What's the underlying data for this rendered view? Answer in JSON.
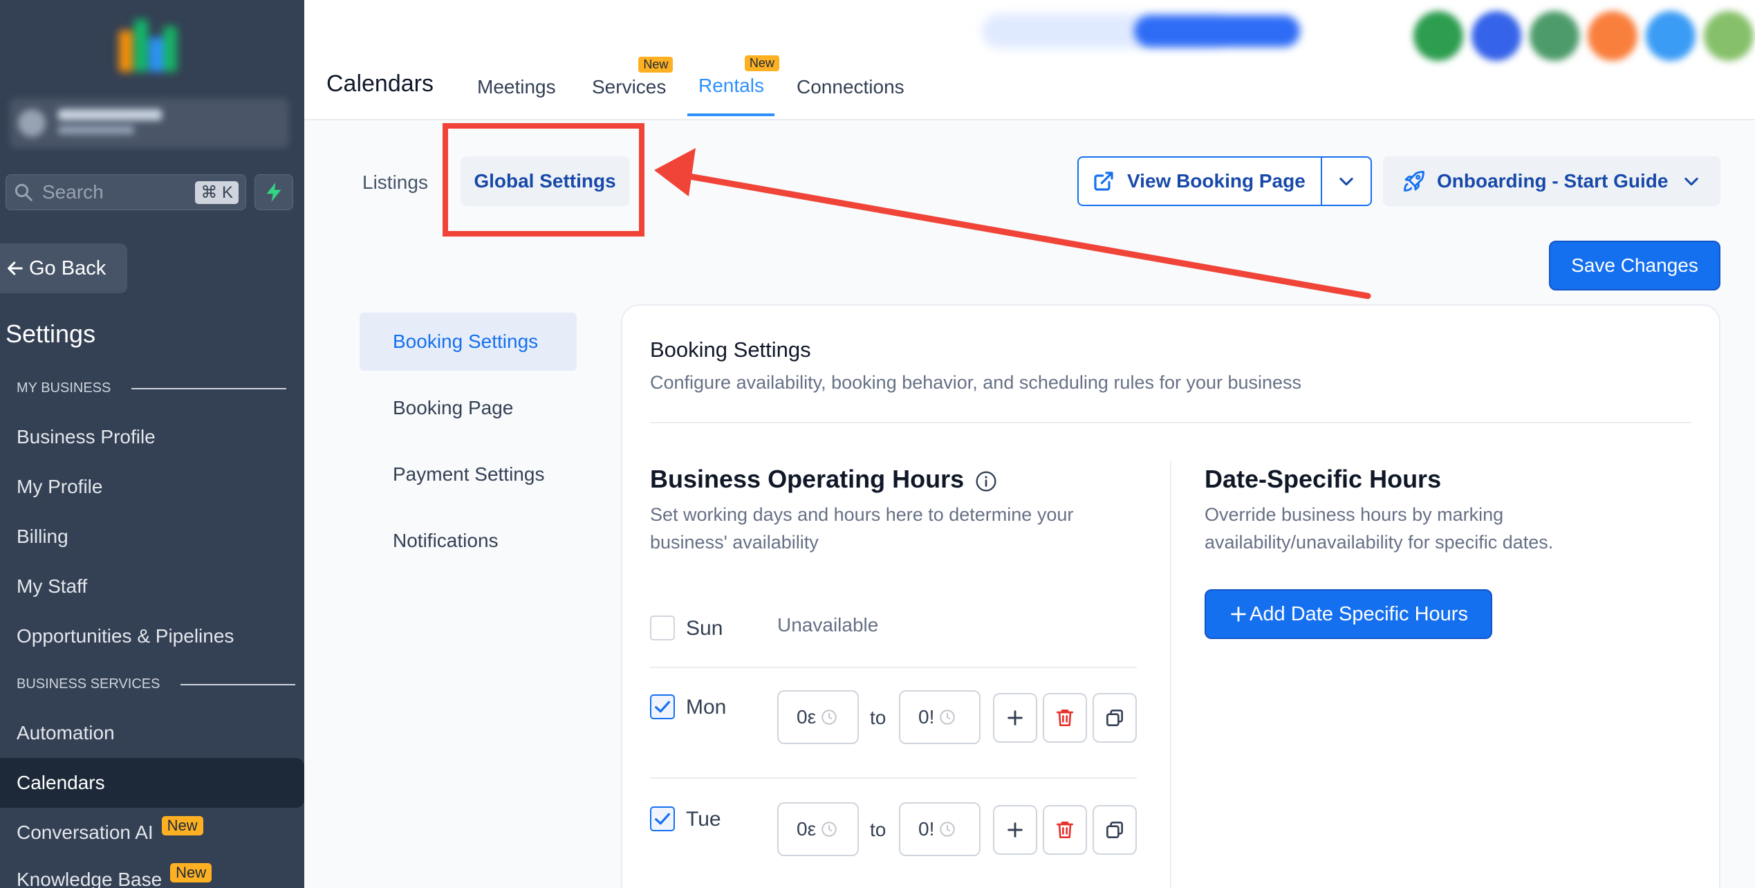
{
  "colors": {
    "sidebar_bg": "#344054",
    "primary": "#1570ef",
    "primary_text": "#1849a9",
    "tab_active": "#2e90fa",
    "badge": "#fdb022",
    "annotation_red": "#f04438"
  },
  "sidebar": {
    "search_placeholder": "Search",
    "search_shortcut": "⌘ K",
    "go_back_label": "Go Back",
    "settings_title": "Settings",
    "sections": [
      {
        "label": "MY BUSINESS"
      },
      {
        "label": "BUSINESS SERVICES"
      }
    ],
    "items": [
      {
        "label": "Business Profile"
      },
      {
        "label": "My Profile"
      },
      {
        "label": "Billing"
      },
      {
        "label": "My Staff"
      },
      {
        "label": "Opportunities & Pipelines"
      },
      {
        "label": "Automation"
      },
      {
        "label": "Calendars",
        "active": true
      },
      {
        "label": "Conversation AI",
        "badge": "New"
      },
      {
        "label": "Knowledge Base",
        "badge": "New"
      }
    ]
  },
  "header": {
    "title": "Calendars",
    "tabs": [
      {
        "label": "Meetings"
      },
      {
        "label": "Services",
        "badge": "New"
      },
      {
        "label": "Rentals",
        "badge": "New",
        "active": true
      },
      {
        "label": "Connections"
      }
    ]
  },
  "subtabs": {
    "listings": "Listings",
    "global_settings": "Global Settings"
  },
  "actions": {
    "view_booking_page": "View Booking Page",
    "onboarding": "Onboarding - Start Guide",
    "save_changes": "Save Changes"
  },
  "settings_nav": [
    {
      "label": "Booking Settings",
      "active": true
    },
    {
      "label": "Booking Page"
    },
    {
      "label": "Payment Settings"
    },
    {
      "label": "Notifications"
    }
  ],
  "card": {
    "title": "Booking Settings",
    "subtitle": "Configure availability, booking behavior, and scheduling rules for your business",
    "operating_hours": {
      "title": "Business Operating Hours",
      "desc_line1": "Set working days and hours here to determine your",
      "desc_line2": "business' availability",
      "days": [
        {
          "label": "Sun",
          "checked": false,
          "status": "Unavailable"
        },
        {
          "label": "Mon",
          "checked": true,
          "from": "0ε",
          "to_label": "to",
          "to": "0!"
        },
        {
          "label": "Tue",
          "checked": true,
          "from": "0ε",
          "to_label": "to",
          "to": "0!"
        }
      ]
    },
    "date_specific": {
      "title": "Date-Specific Hours",
      "desc_line1": "Override business hours by marking",
      "desc_line2": "availability/unavailability for specific dates.",
      "add_button": "Add Date Specific Hours"
    }
  }
}
